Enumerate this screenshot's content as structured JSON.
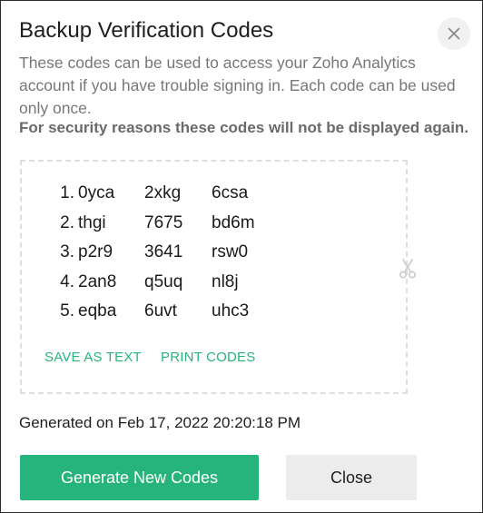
{
  "dialog": {
    "title": "Backup Verification Codes",
    "description": "These codes can be used to access your Zoho Analytics account if you have trouble signing in. Each code can be used only once.",
    "warning": "For security reasons these codes will not be displayed again."
  },
  "codes": [
    {
      "num": "1.",
      "c1": "0yca",
      "c2": "2xkg",
      "c3": "6csa"
    },
    {
      "num": "2.",
      "c1": "thgi",
      "c2": "7675",
      "c3": "bd6m"
    },
    {
      "num": "3.",
      "c1": "p2r9",
      "c2": "3641",
      "c3": "rsw0"
    },
    {
      "num": "4.",
      "c1": "2an8",
      "c2": "q5uq",
      "c3": "nl8j"
    },
    {
      "num": "5.",
      "c1": "eqba",
      "c2": "6uvt",
      "c3": "uhc3"
    }
  ],
  "actions": {
    "save_text": "SAVE AS TEXT",
    "print_codes": "PRINT CODES"
  },
  "generated": "Generated on Feb 17, 2022 20:20:18 PM",
  "buttons": {
    "generate": "Generate New Codes",
    "close": "Close"
  },
  "icons": {
    "close": "close-icon",
    "scissors": "scissors-icon"
  },
  "colors": {
    "accent": "#27b47c",
    "secondary_button": "#ececec",
    "muted_text": "#777777"
  }
}
